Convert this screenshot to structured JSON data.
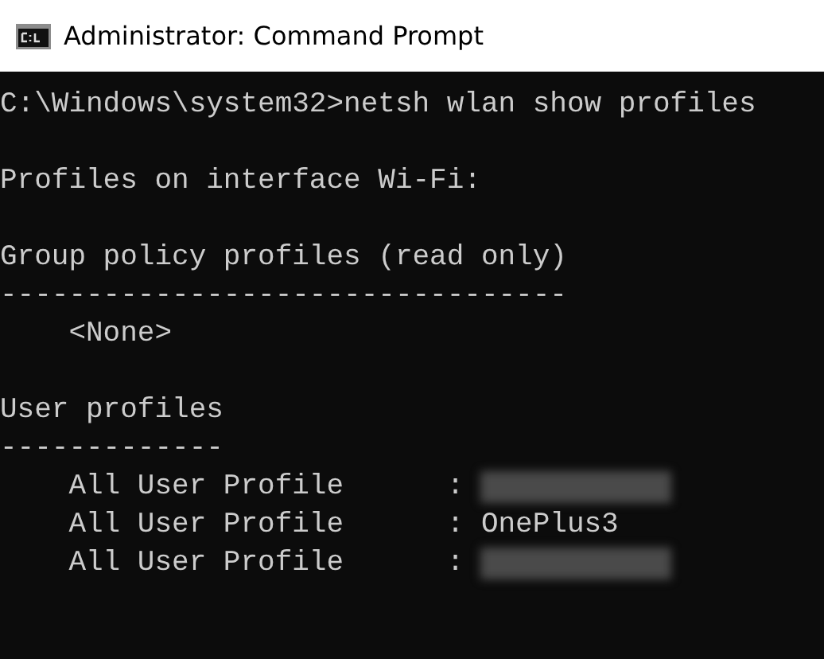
{
  "window": {
    "title": "Administrator: Command Prompt"
  },
  "console": [
    {
      "kind": "text",
      "text": "C:\\Windows\\system32>netsh wlan show profiles"
    },
    {
      "kind": "blank"
    },
    {
      "kind": "text",
      "text": "Profiles on interface Wi-Fi:"
    },
    {
      "kind": "blank"
    },
    {
      "kind": "text",
      "text": "Group policy profiles (read only)"
    },
    {
      "kind": "text",
      "text": "---------------------------------"
    },
    {
      "kind": "indented",
      "text": "<None>"
    },
    {
      "kind": "blank"
    },
    {
      "kind": "text",
      "text": "User profiles"
    },
    {
      "kind": "text",
      "text": "-------------"
    },
    {
      "kind": "profile",
      "label": "All User Profile",
      "separator": ":",
      "redacted": true
    },
    {
      "kind": "profile",
      "label": "All User Profile",
      "separator": ":",
      "value": "OnePlus3",
      "redacted": false
    },
    {
      "kind": "profile",
      "label": "All User Profile",
      "separator": ":",
      "redacted": true
    }
  ]
}
